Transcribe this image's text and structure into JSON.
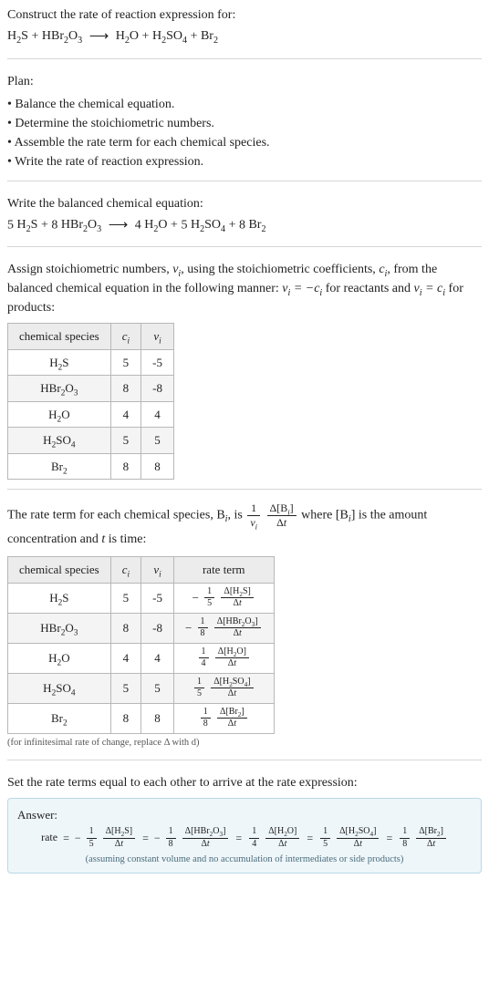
{
  "intro": {
    "prompt": "Construct the rate of reaction expression for:"
  },
  "unbalanced": {
    "lhs": [
      "H_2S",
      "HBr2O3"
    ],
    "rhs": [
      "H_2O",
      "H_2SO_4",
      "Br_2"
    ]
  },
  "plan": {
    "heading": "Plan:",
    "items": [
      "Balance the chemical equation.",
      "Determine the stoichiometric numbers.",
      "Assemble the rate term for each chemical species.",
      "Write the rate of reaction expression."
    ]
  },
  "balanced": {
    "heading": "Write the balanced chemical equation:",
    "lhs": [
      {
        "coef": "5",
        "species": "H_2S"
      },
      {
        "coef": "8",
        "species": "HBr_2O_3"
      }
    ],
    "rhs": [
      {
        "coef": "4",
        "species": "H_2O"
      },
      {
        "coef": "5",
        "species": "H_2SO_4"
      },
      {
        "coef": "8",
        "species": "Br_2"
      }
    ]
  },
  "stoich": {
    "intro_a": "Assign stoichiometric numbers, ",
    "intro_b": ", using the stoichiometric coefficients, ",
    "intro_c": ", from the balanced chemical equation in the following manner: ",
    "intro_d": " for reactants and ",
    "intro_e": " for products:",
    "headers": {
      "species": "chemical species",
      "c": "c_i",
      "nu": "ν_i"
    },
    "rows": [
      {
        "species": "H_2S",
        "c": "5",
        "nu": "-5"
      },
      {
        "species": "HBr_2O_3",
        "c": "8",
        "nu": "-8"
      },
      {
        "species": "H_2O",
        "c": "4",
        "nu": "4"
      },
      {
        "species": "H_2SO_4",
        "c": "5",
        "nu": "5"
      },
      {
        "species": "Br_2",
        "c": "8",
        "nu": "8"
      }
    ]
  },
  "rateterm": {
    "intro_a": "The rate term for each chemical species, B",
    "intro_b": ", is ",
    "intro_c": " where [B",
    "intro_d": "] is the amount concentration and ",
    "intro_e": " is time:",
    "frac_outer_num": "1",
    "frac_outer_den": "ν_i",
    "frac_inner_num": "Δ[B_i]",
    "frac_inner_den": "Δt",
    "headers": {
      "species": "chemical species",
      "c": "c_i",
      "nu": "ν_i",
      "rate": "rate term"
    },
    "rows": [
      {
        "species": "H_2S",
        "c": "5",
        "nu": "-5",
        "sign": "-",
        "coef": "5",
        "dNum": "Δ[H_2S]",
        "dDen": "Δt"
      },
      {
        "species": "HBr_2O_3",
        "c": "8",
        "nu": "-8",
        "sign": "-",
        "coef": "8",
        "dNum": "Δ[HBr_2O_3]",
        "dDen": "Δt"
      },
      {
        "species": "H_2O",
        "c": "4",
        "nu": "4",
        "sign": "",
        "coef": "4",
        "dNum": "Δ[H_2O]",
        "dDen": "Δt"
      },
      {
        "species": "H_2SO_4",
        "c": "5",
        "nu": "5",
        "sign": "",
        "coef": "5",
        "dNum": "Δ[H_2SO_4]",
        "dDen": "Δt"
      },
      {
        "species": "Br_2",
        "c": "8",
        "nu": "8",
        "sign": "",
        "coef": "8",
        "dNum": "Δ[Br_2]",
        "dDen": "Δt"
      }
    ],
    "note": "(for infinitesimal rate of change, replace Δ with d)"
  },
  "final": {
    "lead": "Set the rate terms equal to each other to arrive at the rate expression:",
    "answer_label": "Answer:",
    "rate_word": "rate",
    "terms": [
      {
        "sign": "-",
        "coef": "5",
        "dNum": "Δ[H_2S]",
        "dDen": "Δt"
      },
      {
        "sign": "-",
        "coef": "8",
        "dNum": "Δ[HBr_2O_3]",
        "dDen": "Δt"
      },
      {
        "sign": "",
        "coef": "4",
        "dNum": "Δ[H_2O]",
        "dDen": "Δt"
      },
      {
        "sign": "",
        "coef": "5",
        "dNum": "Δ[H_2SO_4]",
        "dDen": "Δt"
      },
      {
        "sign": "",
        "coef": "8",
        "dNum": "Δ[Br_2]",
        "dDen": "Δt"
      }
    ],
    "assume": "(assuming constant volume and no accumulation of intermediates or side products)"
  }
}
